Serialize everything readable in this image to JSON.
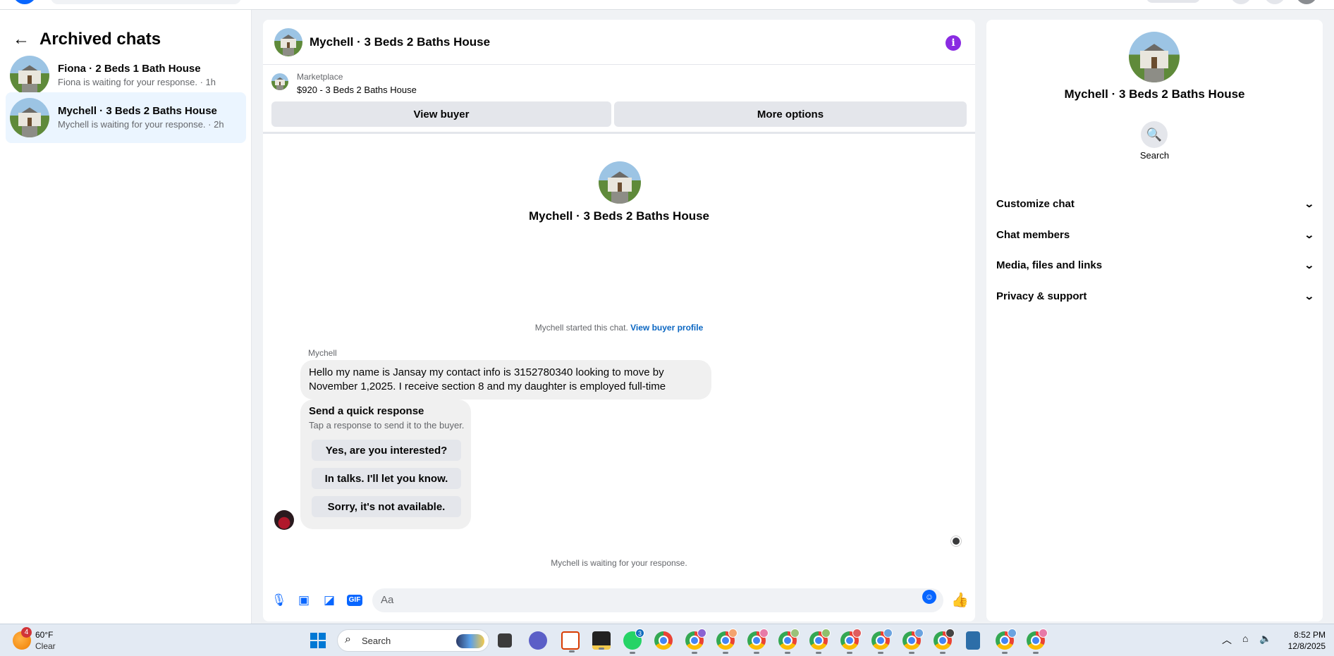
{
  "left_panel": {
    "title": "Archived chats",
    "chats": [
      {
        "title": "Fiona · 2 Beds 1 Bath House",
        "subtitle": "Fiona is waiting for your response. · 1h",
        "active": false
      },
      {
        "title": "Mychell · 3 Beds 2 Baths House",
        "subtitle": "Mychell is waiting for your response. · 2h",
        "active": true
      }
    ]
  },
  "conversation": {
    "title": "Mychell · 3 Beds 2 Baths House",
    "marketplace_label": "Marketplace",
    "listing": "$920 - 3 Beds 2 Baths House",
    "view_buyer_label": "View buyer",
    "more_options_label": "More options",
    "profile_name": "Mychell · 3 Beds 2 Baths House",
    "started_text": "Mychell started this chat.",
    "view_buyer_profile_label": "View buyer profile",
    "sender_name": "Mychell",
    "message": "Hello my name is Jansay my contact info is 3152780340 looking to move by November 1,2025. I receive section 8 and my daughter is employed full-time",
    "quick_response": {
      "title": "Send a quick response",
      "subtitle": "Tap a response to send it to the buyer.",
      "options": [
        "Yes, are you interested?",
        "In talks. I'll let you know.",
        "Sorry, it's not available."
      ]
    },
    "waiting_text": "Mychell is waiting for your response.",
    "composer_placeholder": "Aa"
  },
  "details_panel": {
    "name": "Mychell · 3 Beds 2 Baths House",
    "search_label": "Search",
    "sections": [
      "Customize chat",
      "Chat members",
      "Media, files and links",
      "Privacy & support"
    ]
  },
  "taskbar": {
    "weather_badge": "4",
    "temperature": "60°F",
    "condition": "Clear",
    "search_label": "Search",
    "whatsapp_badge": "3",
    "time": "8:52 PM",
    "date": "12/8/2025"
  },
  "colors": {
    "accent": "#0866ff",
    "active_chat_bg": "#ebf5ff",
    "info_icon": "#8a2be2"
  }
}
